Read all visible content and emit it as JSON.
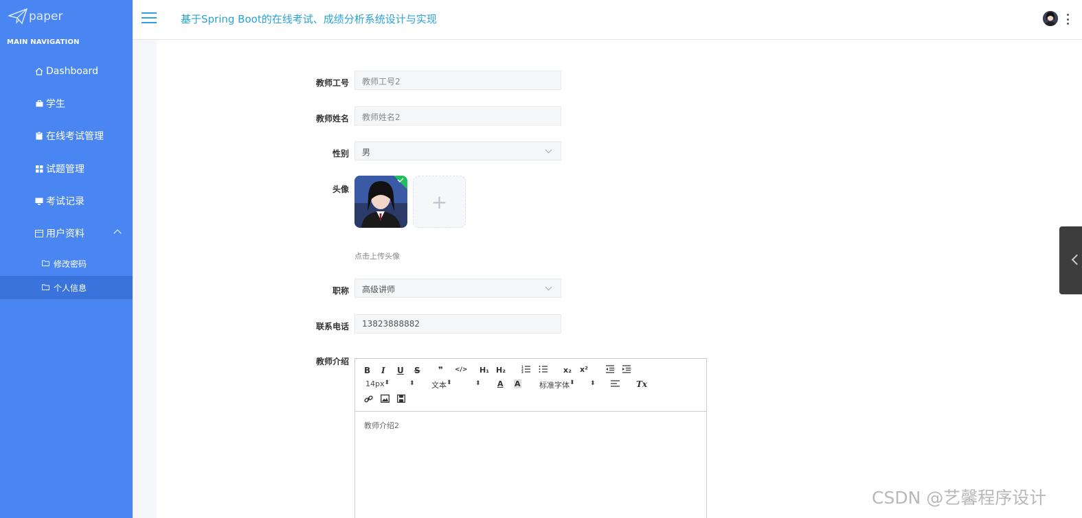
{
  "app": {
    "logo_text": "paper",
    "page_title": "基于Spring Boot的在线考试、成绩分析系统设计与实现"
  },
  "sidebar": {
    "section_title": "MAIN NAVIGATION",
    "items": [
      {
        "label": "Dashboard",
        "icon": "home-icon"
      },
      {
        "label": "学生",
        "icon": "briefcase-icon"
      },
      {
        "label": "在线考试管理",
        "icon": "clipboard-icon"
      },
      {
        "label": "试题管理",
        "icon": "grid-icon"
      },
      {
        "label": "考试记录",
        "icon": "monitor-icon"
      },
      {
        "label": "用户资料",
        "icon": "card-icon"
      }
    ],
    "sub_items": [
      {
        "label": "修改密码",
        "icon": "folder-icon"
      },
      {
        "label": "个人信息",
        "icon": "folder-icon",
        "active": true
      }
    ]
  },
  "form": {
    "teacher_id_label": "教师工号",
    "teacher_id_value": "教师工号2",
    "teacher_name_label": "教师姓名",
    "teacher_name_value": "教师姓名2",
    "gender_label": "性别",
    "gender_value": "男",
    "avatar_label": "头像",
    "upload_plus": "+",
    "avatar_hint": "点击上传头像",
    "title_label": "职称",
    "title_value": "高级讲师",
    "phone_label": "联系电话",
    "phone_value": "13823888882",
    "intro_label": "教师介绍",
    "intro_value": "教师介绍2"
  },
  "editor": {
    "font_size": "14px",
    "text_style": "文本",
    "font_family": "标准字体",
    "buttons": {
      "bold": "B",
      "italic": "I",
      "underline": "U",
      "strike": "S",
      "quote": "❞",
      "code": "</>",
      "h1": "H₁",
      "h2": "H₂",
      "sub": "x₂",
      "sup": "x²",
      "clear": "Tx"
    }
  },
  "watermark": "CSDN @艺馨程序设计",
  "colors": {
    "sidebar_bg": "#4a86f2",
    "sidebar_active": "#3b73dc",
    "title_color": "#29a3d6"
  }
}
